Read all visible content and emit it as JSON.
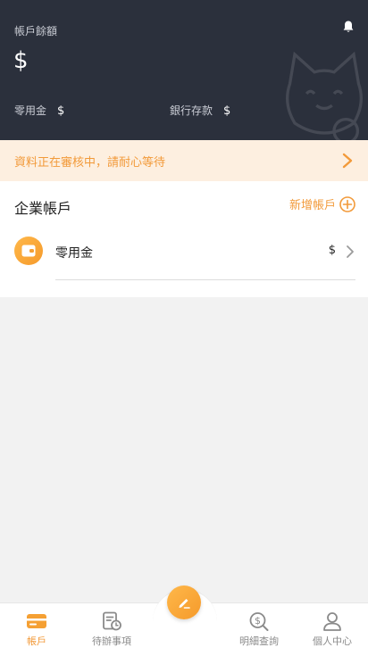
{
  "header": {
    "balance_label": "帳戶餘額",
    "balance_value": "$",
    "petty_cash_label": "零用金",
    "petty_cash_value": "$",
    "bank_deposit_label": "銀行存款",
    "bank_deposit_value": "$",
    "icons": {
      "notification": "bell-icon",
      "mascot": "cat-icon"
    }
  },
  "notice": {
    "text": "資料正在審核中，請耐心等待",
    "icon": "chevron-right-icon"
  },
  "accounts": {
    "title": "企業帳戶",
    "add_label": "新增帳戶",
    "add_icon": "plus-circle-icon",
    "items": [
      {
        "name": "零用金",
        "amount": "$",
        "icon": "wallet-icon"
      }
    ]
  },
  "tabbar": {
    "tabs": [
      {
        "label": "帳戶",
        "icon": "card-icon",
        "active": true
      },
      {
        "label": "待辦事項",
        "icon": "todo-icon",
        "active": false
      },
      {
        "label": "明細查詢",
        "icon": "search-dollar-icon",
        "active": false
      },
      {
        "label": "個人中心",
        "icon": "user-icon",
        "active": false
      }
    ],
    "center_icon": "pencil-icon"
  },
  "colors": {
    "accent": "#f29a3a",
    "header_bg": "#2b303c",
    "notice_bg": "#fdefe0"
  }
}
